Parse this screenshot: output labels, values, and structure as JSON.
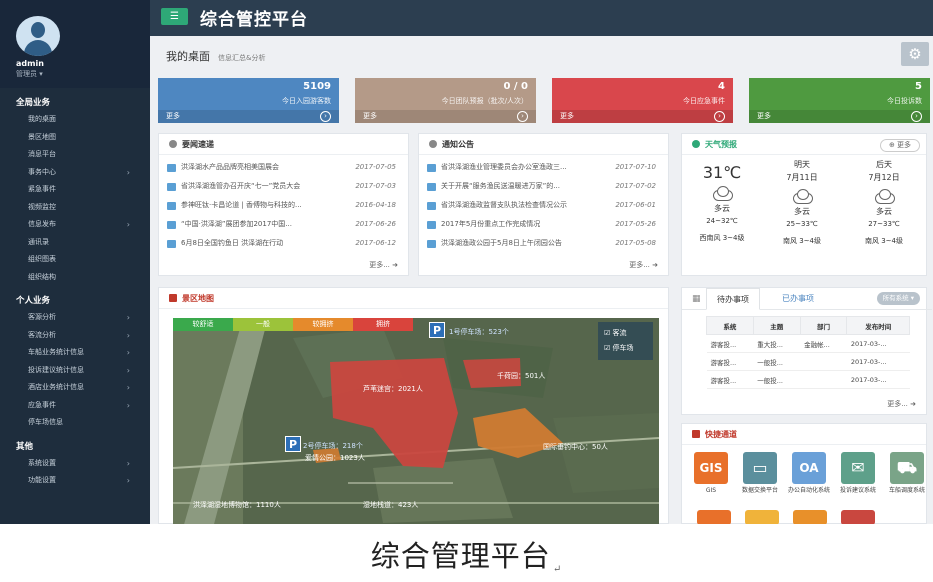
{
  "app": {
    "title": "综合管控平台"
  },
  "user": {
    "name": "admin",
    "role": "管理员 ▾"
  },
  "sidebar": {
    "groups": [
      {
        "title": "全局业务",
        "items": [
          {
            "label": "我的桌面",
            "arrow": ""
          },
          {
            "label": "景区地图",
            "arrow": ""
          },
          {
            "label": "消息平台",
            "arrow": ""
          },
          {
            "label": "事务中心",
            "arrow": "›"
          },
          {
            "label": "紧急事件",
            "arrow": ""
          },
          {
            "label": "视频监控",
            "arrow": ""
          },
          {
            "label": "信息发布",
            "arrow": "›"
          },
          {
            "label": "通讯录",
            "arrow": ""
          },
          {
            "label": "组织图表",
            "arrow": ""
          },
          {
            "label": "组织结构",
            "arrow": ""
          }
        ]
      },
      {
        "title": "个人业务",
        "items": [
          {
            "label": "客源分析",
            "arrow": "›"
          },
          {
            "label": "客流分析",
            "arrow": "›"
          },
          {
            "label": "车船业务统计信息",
            "arrow": "›"
          },
          {
            "label": "投诉建议统计信息",
            "arrow": "›"
          },
          {
            "label": "酒店业务统计信息",
            "arrow": "›"
          },
          {
            "label": "应急事件",
            "arrow": "›"
          },
          {
            "label": "停车场信息",
            "arrow": ""
          }
        ]
      },
      {
        "title": "其他",
        "items": [
          {
            "label": "系统设置",
            "arrow": "›"
          },
          {
            "label": "功能设置",
            "arrow": "›"
          }
        ]
      }
    ]
  },
  "desk": {
    "title": "我的桌面",
    "subtitle": "信息汇总&分析"
  },
  "stats": [
    {
      "value": "5109",
      "label": "今日入园游客数",
      "more": "更多",
      "color": "#4e87c1"
    },
    {
      "value": "0 / 0",
      "label": "今日团队预报（批次/人次）",
      "more": "更多",
      "color": "#b49a88"
    },
    {
      "value": "4",
      "label": "今日应急事件",
      "more": "更多",
      "color": "#d9474c"
    },
    {
      "value": "5",
      "label": "今日投诉数",
      "more": "更多",
      "color": "#4f9a40"
    }
  ],
  "news": {
    "title": "要闻速递",
    "items": [
      {
        "text": "洪泽湖水产品品牌亮相美国展会",
        "date": "2017-07-05"
      },
      {
        "text": "省洪泽湖渔管办召开庆“七一”党员大会",
        "date": "2017-07-03"
      },
      {
        "text": "参神旺钛·卡昌论道 | 香傅物与科技的...",
        "date": "2016-04-18"
      },
      {
        "text": "“中国·洪泽湖”展团参加2017中国...",
        "date": "2017-06-26"
      },
      {
        "text": "6月8日全国钓鱼日  洪泽湖在行动",
        "date": "2017-06-12"
      }
    ],
    "more": "更多..."
  },
  "notices": {
    "title": "通知公告",
    "items": [
      {
        "text": "省洪泽湖渔业管理委员会办公室渔政三...",
        "date": "2017-07-10"
      },
      {
        "text": "关于开展“服务渔民送温暖进万家”的...",
        "date": "2017-07-02"
      },
      {
        "text": "省洪泽湖渔政监督支队执法检查情况公示",
        "date": "2017-06-01"
      },
      {
        "text": "2017年5月份重点工作完成情况",
        "date": "2017-05-26"
      },
      {
        "text": "洪泽湖渔政公园于5月8日上午闭园公告",
        "date": "2017-05-08"
      }
    ],
    "more": "更多..."
  },
  "weather": {
    "title": "天气预报",
    "more": "更多",
    "today": {
      "temp": "31℃",
      "cond": "多云",
      "range": "24~32℃",
      "wind": "西南风 3~4级"
    },
    "days": [
      {
        "name": "明天",
        "date": "7月11日",
        "cond": "多云",
        "range": "25~33℃",
        "wind": "南风 3~4级"
      },
      {
        "name": "后天",
        "date": "7月12日",
        "cond": "多云",
        "range": "27~33℃",
        "wind": "南风 3~4级"
      }
    ]
  },
  "map": {
    "title": "景区地图",
    "legend": [
      {
        "label": "较舒适",
        "color": "#3aa94c"
      },
      {
        "label": "一般",
        "color": "#9cc33a"
      },
      {
        "label": "较拥挤",
        "color": "#e58a2c"
      },
      {
        "label": "拥挤",
        "color": "#d9443c"
      }
    ],
    "checks": [
      "客流",
      "停车场"
    ],
    "labels": {
      "p1": "1号停车场：523个",
      "p2": "2号停车场：218个",
      "maze": "芦苇迷宫：2021人",
      "area1": "千荷园：501人",
      "area2": "国际垂钓中心：50人",
      "area3": "爱情公园：1023人",
      "area4": "洪泽湖湿地博物馆：1110人",
      "area5": "湿地栈道：423人"
    }
  },
  "todo": {
    "tabs": [
      "待办事项",
      "已办事项"
    ],
    "selector": "所有系统 ▾",
    "headers": [
      "系统",
      "主题",
      "部门",
      "发布时间"
    ],
    "rows": [
      [
        "游客投...",
        "重大投...",
        "金融帐...",
        "2017-03-..."
      ],
      [
        "游客投...",
        "一般投...",
        "",
        "2017-03-..."
      ],
      [
        "游客投...",
        "一般投...",
        "",
        "2017-03-..."
      ]
    ],
    "more": "更多..."
  },
  "quick": {
    "title": "快捷通道",
    "items": [
      {
        "icon": "GIS",
        "label": "GIS",
        "color": "#e8702a"
      },
      {
        "icon": "▭",
        "label": "数据交换平台",
        "color": "#5b8f9d"
      },
      {
        "icon": "OA",
        "label": "办公自动化系统",
        "color": "#6aa0d8"
      },
      {
        "icon": "✉",
        "label": "投诉建议系统",
        "color": "#5ea08a"
      },
      {
        "icon": "⛟",
        "label": "车船调度系统",
        "color": "#7aa488"
      }
    ]
  },
  "caption": {
    "text": "综合管理平台",
    "mark": "↵"
  }
}
